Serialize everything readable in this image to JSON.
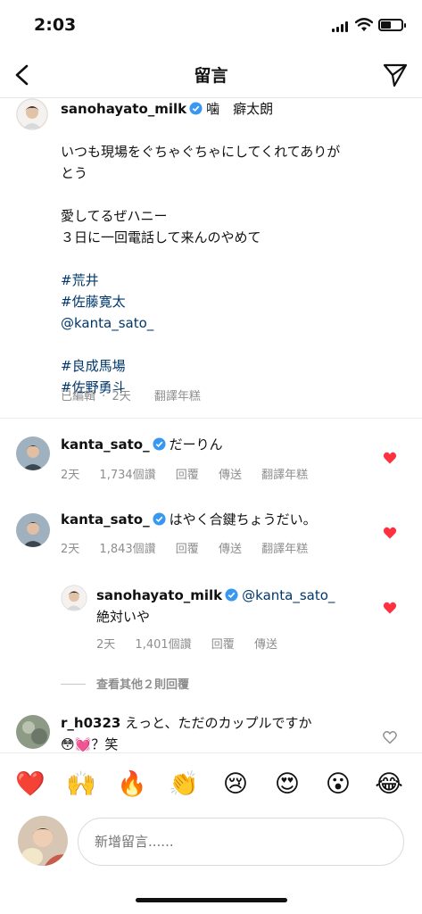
{
  "status_bar": {
    "time": "2:03",
    "battery_level": 0.45
  },
  "header": {
    "title": "留言",
    "back_icon": "chevron-left-icon",
    "send_icon": "paper-plane-icon"
  },
  "caption": {
    "username": "sanohayato_milk",
    "name_suffix": "噛　癖太朗",
    "lines": [
      "いつも現場をぐちゃぐちゃにしてくれてありが",
      "とう",
      "",
      "愛してるぜハニー",
      "３日に一回電話して来んのやめて",
      "",
      "#荒井",
      "#佐藤寛太",
      "@kanta_sato_",
      "",
      "#良成馬場",
      "#佐野勇斗"
    ],
    "meta": {
      "edited": "已編輯",
      "dot": "·",
      "age": "2天",
      "translate": "翻譯年糕"
    }
  },
  "comments": [
    {
      "username": "kanta_sato_",
      "text": "だーりん",
      "age": "2天",
      "views": "1,734個讚",
      "reply": "回覆",
      "send": "傳送",
      "translate": "翻譯年糕",
      "liked": true
    },
    {
      "username": "kanta_sato_",
      "text": "はやく合鍵ちょうだい。",
      "age": "2天",
      "views": "1,843個讚",
      "reply": "回覆",
      "send": "傳送",
      "translate": "翻譯年糕",
      "liked": true
    }
  ],
  "reply": {
    "username": "sanohayato_milk",
    "mention": "@kanta_sato_",
    "text": "絶対いや",
    "age": "2天",
    "views": "1,401個讚",
    "reply": "回覆",
    "send": "傳送",
    "liked": true
  },
  "more_replies": "查看其他２則回覆",
  "last_comment": {
    "username": "r_h0323",
    "text": "えっと、ただのカップルですか",
    "line2": "？笑",
    "emojis": [
      "😳",
      "💓"
    ]
  },
  "emoji_bar": [
    "❤️",
    "🙌",
    "🔥",
    "👏",
    "😢",
    "😍",
    "😮",
    "😂"
  ],
  "compose": {
    "placeholder": "新增留言......"
  },
  "colors": {
    "heart": "#ff3040",
    "verified": "#3897f0",
    "link": "#00376b",
    "muted": "#8e8e8e"
  }
}
